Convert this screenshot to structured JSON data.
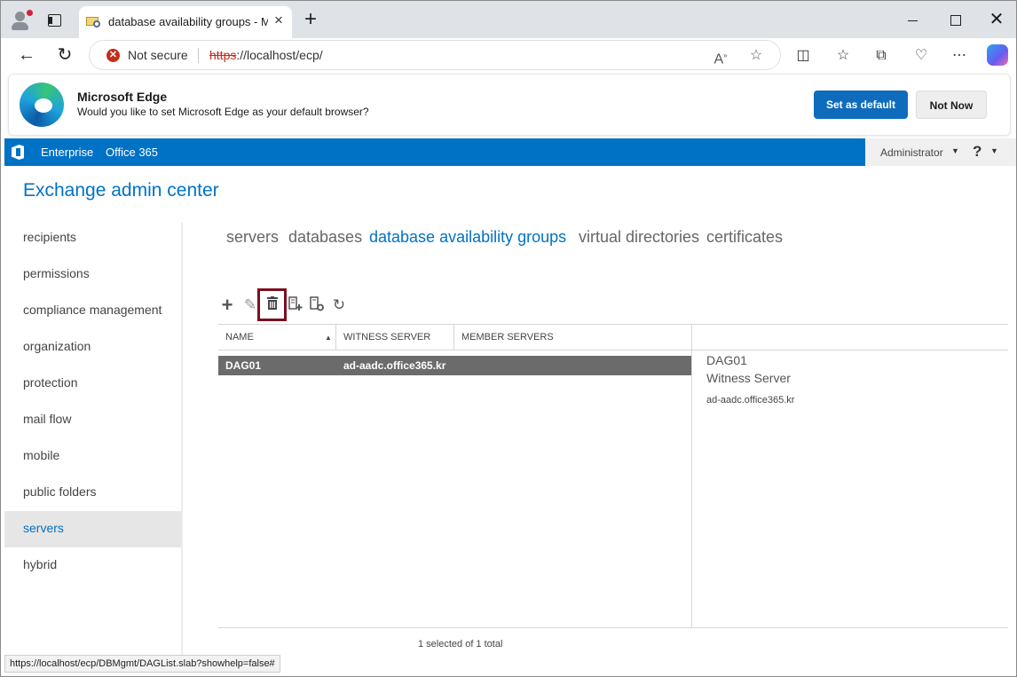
{
  "browser": {
    "tab_title": "database availability groups - Mic",
    "security_label": "Not secure",
    "url_scheme": "https",
    "url_rest": "://localhost/ecp/",
    "status_url": "https://localhost/ecp/DBMgmt/DAGList.slab?showhelp=false#"
  },
  "infobar": {
    "title": "Microsoft Edge",
    "message": "Would you like to set Microsoft Edge as your default browser?",
    "primary_button": "Set as default",
    "secondary_button": "Not Now",
    "primary_color": "#0f6cbd"
  },
  "topnav": {
    "items": [
      "Enterprise",
      "Office 365"
    ],
    "user": "Administrator",
    "help_label": "?",
    "bar_color": "#0072c6"
  },
  "page": {
    "title": "Exchange admin center"
  },
  "leftnav": {
    "items": [
      "recipients",
      "permissions",
      "compliance management",
      "organization",
      "protection",
      "mail flow",
      "mobile",
      "public folders",
      "servers",
      "hybrid"
    ],
    "selected": "servers"
  },
  "subtabs": {
    "items": [
      "servers",
      "databases",
      "database availability groups",
      "virtual directories",
      "certificates"
    ],
    "active": "database availability groups"
  },
  "toolbar": {
    "icons": [
      "add-icon",
      "edit-icon",
      "delete-icon",
      "add-server-icon",
      "manage-network-icon",
      "refresh-icon"
    ],
    "highlighted": "delete-icon",
    "highlight_color": "#7a1020"
  },
  "list": {
    "columns": [
      "NAME",
      "WITNESS SERVER",
      "MEMBER SERVERS"
    ],
    "rows": [
      {
        "name": "DAG01",
        "witness_server": "ad-aadc.office365.kr",
        "member_servers": ""
      }
    ],
    "footer": "1 selected of 1 total"
  },
  "details": {
    "name": "DAG01",
    "label": "Witness Server",
    "value": "ad-aadc.office365.kr"
  }
}
